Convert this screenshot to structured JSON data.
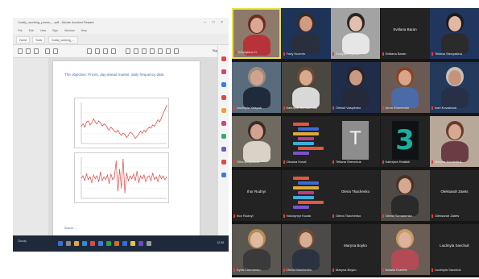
{
  "shared_screen": {
    "window_title": "Costly_working_prices_...pdf - Adobe Acrobat Reader",
    "menu": [
      "File",
      "Edit",
      "View",
      "Sign",
      "Window",
      "Help"
    ],
    "tabs": [
      "Home",
      "Tools",
      "Costly_working_..."
    ],
    "toolbar_right": "Sign in",
    "page_heading": "The objective: Prices, day-ahead market, daily frequency data",
    "figure_note": "Source: ...",
    "taskbar": {
      "weather": "Cloudy",
      "clock": "12:08"
    }
  },
  "participants": [
    {
      "name": "Khudykina O.",
      "kind": "person",
      "active": true,
      "skin": "#d9a792",
      "hair": "#6b2e20",
      "shirt": "#b8323a",
      "bg": "#8d7a6a"
    },
    {
      "name": "Yuriy Kuzmin",
      "kind": "person",
      "skin": "#cf9b83",
      "hair": "#3d2a22",
      "shirt": "#2a2f3e",
      "bg": "#1d3357"
    },
    {
      "name": "Kostyan Hryshan",
      "kind": "person",
      "skin": "#e0c0ad",
      "hair": "#2a2424",
      "shirt": "#e6e6e6",
      "bg": "#a3a3a3"
    },
    {
      "name": "Svitlana Baran",
      "kind": "name",
      "center": "Svitlana Baran"
    },
    {
      "name": "Tetiana Stenyakina",
      "kind": "person",
      "skin": "#e0b8a4",
      "hair": "#1f1a1a",
      "shirt": "#2b2b2b",
      "bg": "#20365e"
    },
    {
      "name": "Liudmyla Yatsyuk",
      "kind": "person",
      "skin": "#cfa48f",
      "hair": "#9e8c7a",
      "shirt": "#1f2a3a",
      "bg": "#596c7e"
    },
    {
      "name": "Kateryna Bondarenko",
      "kind": "person",
      "skin": "#d8a98e",
      "hair": "#6a4a35",
      "shirt": "#d8d8d8",
      "bg": "#4a4640"
    },
    {
      "name": "Oleksii Vasylenko",
      "kind": "person",
      "skin": "#c99983",
      "hair": "#2f2220",
      "shirt": "#252a3a",
      "bg": "#1f2d4a"
    },
    {
      "name": "Anna Khomenko",
      "kind": "person",
      "skin": "#d9a58a",
      "hair": "#8a4226",
      "shirt": "#4a6aa8",
      "bg": "#6b5a54"
    },
    {
      "name": "Ivan Kovalchuk",
      "kind": "person",
      "skin": "#c8917c",
      "hair": "#c8c0b8",
      "shirt": "#273046",
      "bg": "#233a5c"
    },
    {
      "name": "Olha Bezpalova",
      "kind": "person",
      "skin": "#d2a28e",
      "hair": "#3a2c26",
      "shirt": "#d9d2c6",
      "bg": "#6f6a60"
    },
    {
      "name": "Oksana Koval",
      "kind": "logo"
    },
    {
      "name": "Tetiana Shevchuk",
      "kind": "T"
    },
    {
      "name": "Kateryna Hnatiuk",
      "kind": "3"
    },
    {
      "name": "Maryna Kondratiuk",
      "kind": "person",
      "skin": "#d5a993",
      "hair": "#6a3a26",
      "shirt": "#6a3d45",
      "bg": "#b7a89a"
    },
    {
      "name": "Ihor Rudnyi",
      "kind": "name",
      "center": "Ihor Rudnyi"
    },
    {
      "name": "Volodymyr Kozak",
      "kind": "logo"
    },
    {
      "name": "Olena Tkachenko",
      "kind": "name",
      "center": "Olena Tkachenko"
    },
    {
      "name": "Olena Romanenko",
      "kind": "person",
      "skin": "#d6a88f",
      "hair": "#4a3024",
      "shirt": "#2a2a2a",
      "bg": "#4f4a46"
    },
    {
      "name": "Oleksandr Zaiets",
      "kind": "name",
      "center": "Oleksandr Zaiets"
    },
    {
      "name": "Iryna Chernenko",
      "kind": "person",
      "skin": "#e0b9a2",
      "hair": "#b88a50",
      "shirt": "#3a3a3a",
      "bg": "#5a5650"
    },
    {
      "name": "Olena Marchenko",
      "kind": "person",
      "skin": "#d7ac92",
      "hair": "#6e4a33",
      "shirt": "#2c3340",
      "bg": "#4c4a48"
    },
    {
      "name": "Maryna Boyko",
      "kind": "name",
      "center": "Maryna Boyko"
    },
    {
      "name": "Natalia Kravets",
      "kind": "person",
      "skin": "#dcb29c",
      "hair": "#c79b64",
      "shirt": "#b34a55",
      "bg": "#6a5d55"
    },
    {
      "name": "Liudmyla Savchuk",
      "kind": "name",
      "center": "Liudmyla Savchuk"
    }
  ],
  "colors": {
    "gallery_bg": "#161616",
    "tile_bg": "#232323",
    "active_border": "#e8e14d",
    "mic_muted": "#e23c3c",
    "chart_line": "#d94a48"
  },
  "chart_data": [
    {
      "type": "line",
      "values": [
        42,
        44,
        41,
        46,
        47,
        43,
        45,
        49,
        46,
        44,
        47,
        45,
        42,
        44,
        43,
        40,
        38,
        41,
        39,
        37,
        36,
        38,
        35,
        33,
        35,
        34,
        31,
        33,
        36,
        35,
        33,
        30,
        32,
        34,
        37,
        35,
        38,
        36,
        39,
        41,
        40,
        43,
        42,
        45,
        48,
        46,
        50,
        54,
        58,
        62
      ],
      "ylim": [
        25,
        65
      ]
    },
    {
      "type": "line",
      "values": [
        0,
        2,
        -3,
        4,
        -2,
        1,
        -5,
        3,
        -1,
        2,
        -4,
        6,
        -3,
        1,
        -2,
        3,
        -6,
        4,
        -2,
        1,
        18,
        -14,
        9,
        -11,
        20,
        -16,
        5,
        -3,
        2,
        -1,
        4,
        -3,
        7,
        -5,
        2,
        -1,
        3,
        -4,
        1,
        2,
        -3,
        5,
        -2,
        1,
        -4,
        3,
        -1,
        2,
        -2,
        1
      ],
      "ylim": [
        -22,
        22
      ]
    }
  ]
}
